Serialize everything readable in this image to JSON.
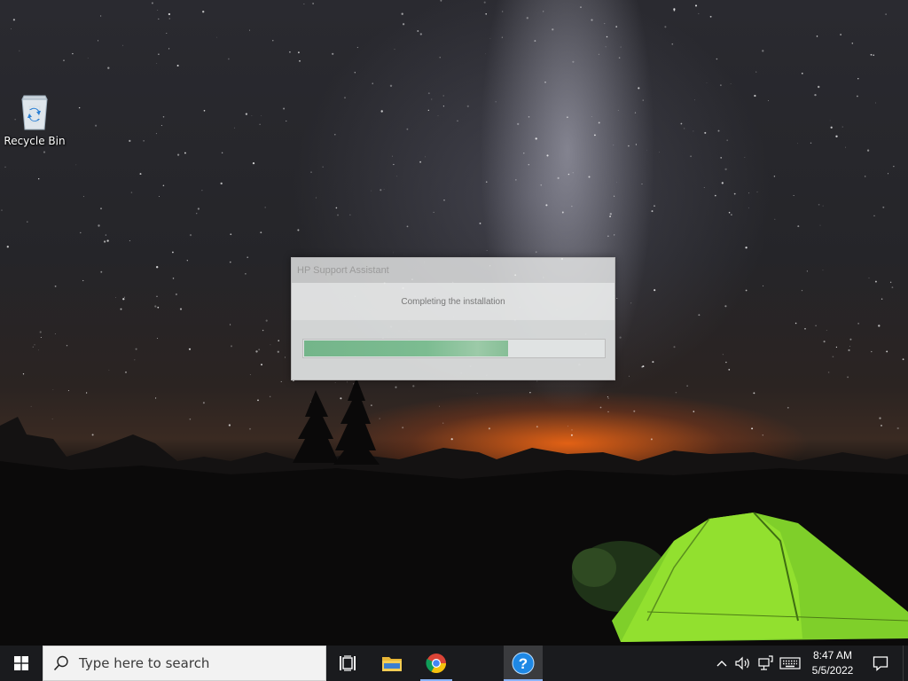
{
  "desktop": {
    "icons": [
      {
        "label": "Recycle Bin",
        "icon": "recycle-bin-icon"
      }
    ]
  },
  "dialog": {
    "title": "HP Support Assistant",
    "status_text": "Completing the installation",
    "progress_percent": 68
  },
  "taskbar": {
    "search_placeholder": "Type here to search",
    "pinned": [
      {
        "name": "task-view",
        "icon": "task-view-icon"
      },
      {
        "name": "file-explorer",
        "icon": "folder-icon"
      },
      {
        "name": "chrome",
        "icon": "chrome-icon",
        "running": true
      },
      {
        "name": "help",
        "icon": "help-icon",
        "running": true,
        "active": true
      }
    ],
    "clock": {
      "time": "8:47 AM",
      "date": "5/5/2022"
    },
    "tray": [
      "chevron-up-icon",
      "volume-icon",
      "network-icon",
      "keyboard-icon",
      "notification-icon"
    ]
  }
}
